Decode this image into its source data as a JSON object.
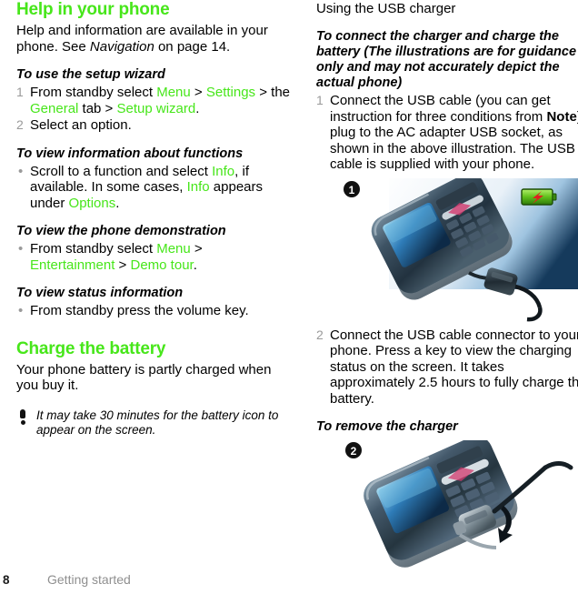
{
  "document": {
    "page_number": "8",
    "footer_label": "Getting started"
  },
  "left_column": {
    "section_title": "Help in your phone",
    "intro": {
      "part1": "Help and information are available in your phone. See ",
      "nav_italic": "Navigation",
      "part2": " on page 14."
    },
    "procedure_setup_wizard": {
      "heading": "To use the setup wizard",
      "step1": {
        "marker": "1",
        "t1": "From standby select ",
        "menu": "Menu",
        "sep1": " > ",
        "settings": "Settings",
        "t2": " > the ",
        "general": "General",
        "t3": " tab > ",
        "setup_wizard": "Setup wizard",
        "t4": "."
      },
      "step2": {
        "marker": "2",
        "text": "Select an option."
      }
    },
    "procedure_view_info": {
      "heading": "To view information about functions",
      "bullet": {
        "marker": "•",
        "t1": "Scroll to a function and select ",
        "info1": "Info",
        "t2": ", if available. In some cases, ",
        "info2": "Info",
        "t3": " appears under ",
        "options": "Options",
        "t4": "."
      }
    },
    "procedure_demo": {
      "heading": "To view the phone demonstration",
      "bullet": {
        "marker": "•",
        "t1": "From standby select ",
        "menu": "Menu",
        "t2": " > ",
        "entertainment": "Entertainment",
        "t3": " > ",
        "demo_tour": "Demo tour",
        "t4": "."
      }
    },
    "procedure_status": {
      "heading": "To view status information",
      "bullet": {
        "marker": "•",
        "text": "From standby press the volume key."
      }
    },
    "section_title_2": "Charge the battery",
    "charge_intro": "Your phone battery is partly charged when you buy it.",
    "note": {
      "icon": "exclamation-icon",
      "text": "It may take 30 minutes for the battery icon to appear on the screen."
    }
  },
  "right_column": {
    "sub_head": "Using the USB charger",
    "procedure_connect": {
      "heading": "To connect the charger and charge the battery (The illustrations are for guidance only and may not accurately depict the actual phone)",
      "step1": {
        "marker": "1",
        "t1": "Connect the USB cable (you can get instruction for three conditions from ",
        "note_bold": "Note",
        "t2": ") plug to the AC adapter USB socket, as shown in the above illustration. The USB cable is supplied with your phone."
      },
      "step2": {
        "marker": "2",
        "text": "Connect the USB cable connector to your phone. Press a key to view the charging status on the screen. It takes approximately 2.5 hours to fully charge the battery."
      }
    },
    "illustration_1": {
      "badge": "1",
      "alt": "phone-with-usb-charger-connected",
      "battery_icon": "battery-charging-icon"
    },
    "procedure_remove": {
      "heading": "To remove the charger"
    },
    "illustration_2": {
      "badge": "2",
      "alt": "phone-with-charger-being-removed",
      "arrow": "remove-arrow-icon"
    }
  },
  "colors": {
    "accent_green": "#47e61a",
    "marker_gray": "#9a9a9a",
    "footer_gray": "#8f8f8f",
    "text_black": "#000000"
  }
}
